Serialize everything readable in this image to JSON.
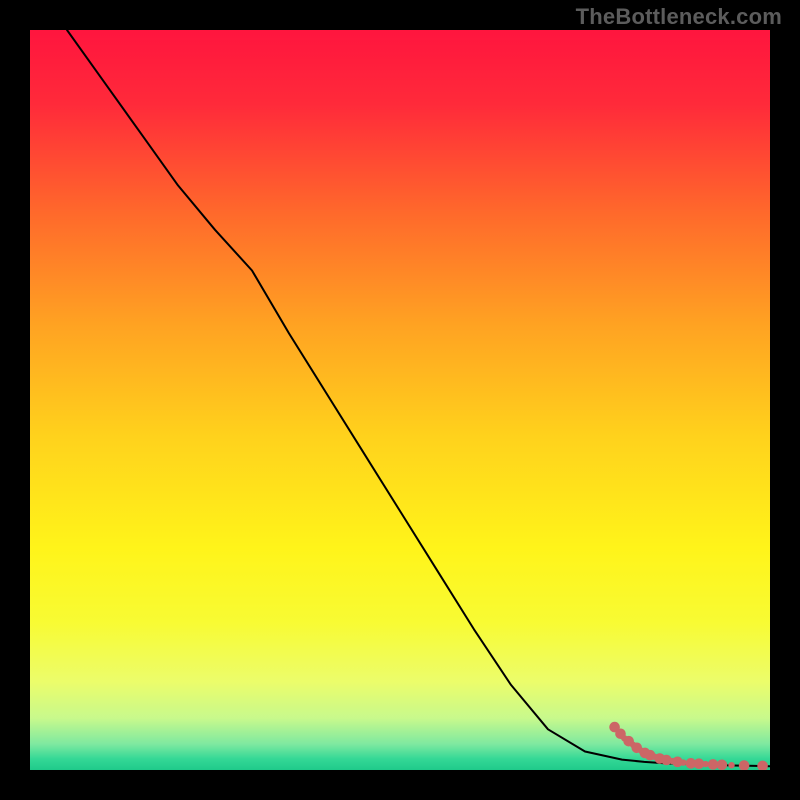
{
  "watermark": "TheBottleneck.com",
  "chart_data": {
    "type": "line",
    "title": "",
    "xlabel": "",
    "ylabel": "",
    "xlim": [
      0,
      100
    ],
    "ylim": [
      0,
      100
    ],
    "gradient": [
      {
        "offset": 0.0,
        "color": "#ff153e"
      },
      {
        "offset": 0.1,
        "color": "#ff2a3a"
      },
      {
        "offset": 0.25,
        "color": "#ff6a2b"
      },
      {
        "offset": 0.4,
        "color": "#ffa322"
      },
      {
        "offset": 0.55,
        "color": "#ffd21c"
      },
      {
        "offset": 0.7,
        "color": "#fff41a"
      },
      {
        "offset": 0.8,
        "color": "#f8fb33"
      },
      {
        "offset": 0.88,
        "color": "#ecfd6a"
      },
      {
        "offset": 0.93,
        "color": "#c8f98c"
      },
      {
        "offset": 0.965,
        "color": "#7ee9a0"
      },
      {
        "offset": 0.985,
        "color": "#34d896"
      },
      {
        "offset": 1.0,
        "color": "#1fca8a"
      }
    ],
    "series": [
      {
        "name": "bottleneck-curve",
        "color": "#000000",
        "x": [
          5,
          10,
          15,
          20,
          25,
          30,
          35,
          40,
          45,
          50,
          55,
          60,
          65,
          70,
          75,
          80,
          83,
          86,
          89,
          92,
          95,
          98,
          100
        ],
        "y": [
          100,
          93,
          86,
          79,
          73,
          67.5,
          59,
          51,
          43,
          35,
          27,
          19,
          11.5,
          5.5,
          2.5,
          1.4,
          1.1,
          0.9,
          0.8,
          0.7,
          0.6,
          0.55,
          0.5
        ]
      }
    ],
    "points": {
      "name": "near-zero-points",
      "color": "#cc6666",
      "radius_major": 5.3,
      "radius_minor": 3.2,
      "data": [
        {
          "x": 79.0,
          "y": 5.8,
          "r": "major"
        },
        {
          "x": 79.8,
          "y": 4.9,
          "r": "major"
        },
        {
          "x": 80.3,
          "y": 4.3,
          "r": "minor"
        },
        {
          "x": 80.9,
          "y": 3.9,
          "r": "major"
        },
        {
          "x": 81.5,
          "y": 3.4,
          "r": "minor"
        },
        {
          "x": 82.0,
          "y": 3.0,
          "r": "major"
        },
        {
          "x": 82.6,
          "y": 2.6,
          "r": "minor"
        },
        {
          "x": 83.1,
          "y": 2.3,
          "r": "major"
        },
        {
          "x": 83.8,
          "y": 2.0,
          "r": "major"
        },
        {
          "x": 84.4,
          "y": 1.8,
          "r": "minor"
        },
        {
          "x": 85.1,
          "y": 1.55,
          "r": "major"
        },
        {
          "x": 86.0,
          "y": 1.35,
          "r": "major"
        },
        {
          "x": 86.8,
          "y": 1.2,
          "r": "minor"
        },
        {
          "x": 87.5,
          "y": 1.1,
          "r": "major"
        },
        {
          "x": 88.3,
          "y": 1.0,
          "r": "minor"
        },
        {
          "x": 89.3,
          "y": 0.9,
          "r": "major"
        },
        {
          "x": 90.4,
          "y": 0.85,
          "r": "major"
        },
        {
          "x": 91.3,
          "y": 0.8,
          "r": "minor"
        },
        {
          "x": 92.3,
          "y": 0.75,
          "r": "major"
        },
        {
          "x": 93.5,
          "y": 0.7,
          "r": "major"
        },
        {
          "x": 94.8,
          "y": 0.65,
          "r": "minor"
        },
        {
          "x": 96.5,
          "y": 0.6,
          "r": "major"
        },
        {
          "x": 99.0,
          "y": 0.55,
          "r": "major"
        }
      ]
    }
  }
}
